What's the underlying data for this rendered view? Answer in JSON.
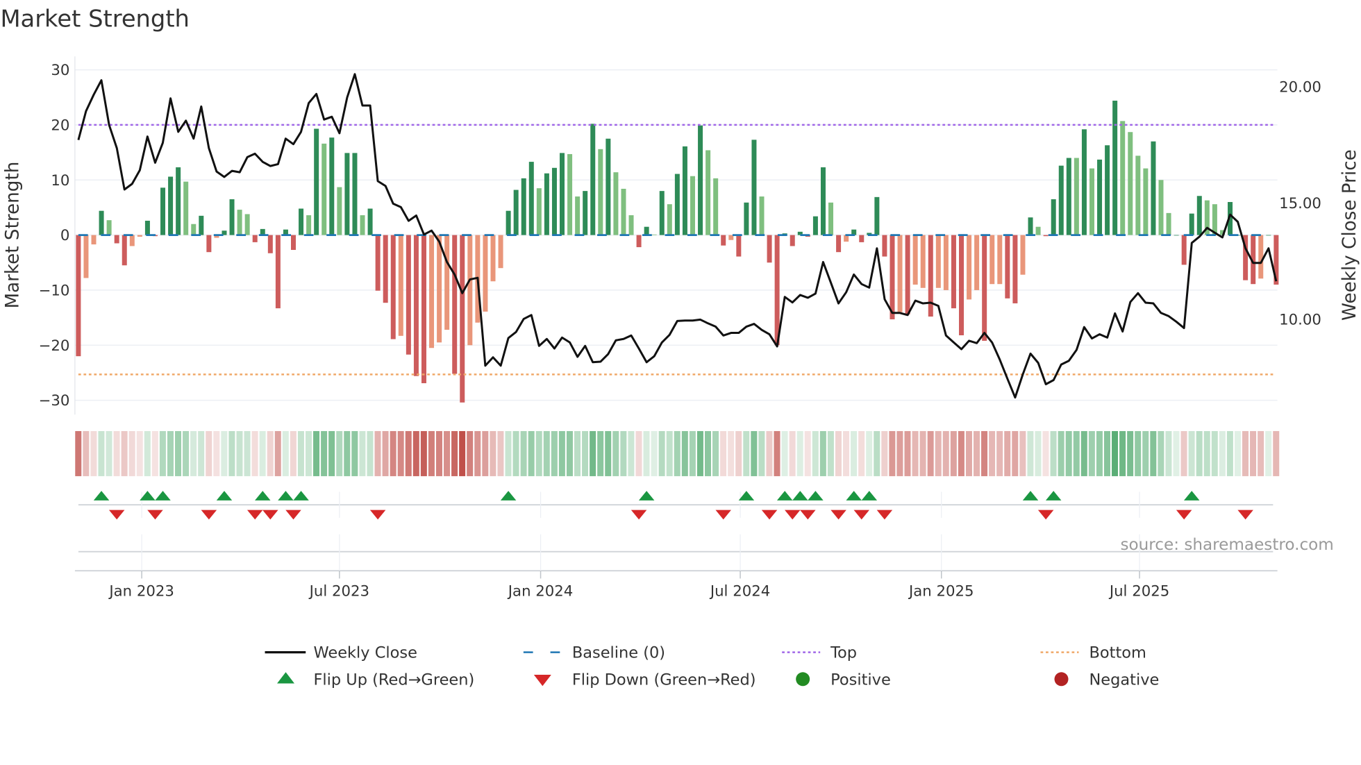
{
  "title": "Market Strength",
  "source_note": "source: sharemaestro.com",
  "colors": {
    "bar_pos_dark": "#2e8b57",
    "bar_pos_light": "#7fbf7f",
    "bar_neg_dark": "#cd5c5c",
    "bar_neg_light": "#e9967a",
    "close_line": "#111111",
    "baseline": "#1f77b4",
    "top_line": "#a066e8",
    "bottom_line": "#f0a868",
    "flip_up": "#1a9641",
    "flip_down": "#d62728",
    "positive": "#228b22",
    "negative": "#b22222",
    "strip_pos": "#3c9f5c",
    "strip_neg": "#c0504a",
    "grid": "#eceff4"
  },
  "legend": [
    {
      "key": "weekly_close",
      "label": "Weekly Close",
      "symbol": "solid-line"
    },
    {
      "key": "baseline",
      "label": "Baseline (0)",
      "symbol": "dashed-line"
    },
    {
      "key": "top",
      "label": "Top",
      "symbol": "dotted-line-purple"
    },
    {
      "key": "bottom",
      "label": "Bottom",
      "symbol": "dotted-line-orange"
    },
    {
      "key": "flip_up",
      "label": "Flip Up (Red→Green)",
      "symbol": "triangle-up"
    },
    {
      "key": "flip_down",
      "label": "Flip Down (Green→Red)",
      "symbol": "triangle-down"
    },
    {
      "key": "positive",
      "label": "Positive",
      "symbol": "dot-green"
    },
    {
      "key": "negative",
      "label": "Negative",
      "symbol": "dot-red"
    }
  ],
  "chart_data": {
    "type": "bar",
    "title": "Market Strength",
    "ylabel": "Market Strength",
    "y2label": "Weekly Close Price",
    "ylim": [
      -32.5,
      33
    ],
    "y2lim": [
      6.06,
      21.3
    ],
    "yticks": [
      {
        "value": 30,
        "label": "30"
      },
      {
        "value": 20,
        "label": "20"
      },
      {
        "value": 10,
        "label": "10"
      },
      {
        "value": 0,
        "label": "0"
      },
      {
        "value": -10,
        "label": "−10"
      },
      {
        "value": -20,
        "label": "−20"
      },
      {
        "value": -30,
        "label": "−30"
      }
    ],
    "y2ticks": [
      {
        "value": 20,
        "label": "20.00"
      },
      {
        "value": 15,
        "label": "15.00"
      },
      {
        "value": 10,
        "label": "10.00"
      }
    ],
    "x_unit": "week index",
    "xticks": [
      {
        "week": 8.25,
        "label": "Jan 2023"
      },
      {
        "week": 34.0,
        "label": "Jul 2023"
      },
      {
        "week": 60.2,
        "label": "Jan 2024"
      },
      {
        "week": 86.2,
        "label": "Jul 2024"
      },
      {
        "week": 112.4,
        "label": "Jan 2025"
      },
      {
        "week": 138.2,
        "label": "Jul 2025"
      }
    ],
    "top_level": 20,
    "bottom_level": -25.3,
    "baseline": 0,
    "strength": [
      -22,
      -7.8,
      -1.7,
      4.4,
      2.7,
      -1.5,
      -5.5,
      -2,
      -0.3,
      2.6,
      -0.2,
      8.6,
      10.6,
      12.3,
      9.7,
      2,
      3.5,
      -3.1,
      -0.5,
      0.8,
      6.5,
      4.6,
      3.8,
      -1.3,
      1.1,
      -3.3,
      -13.3,
      1,
      -2.7,
      4.8,
      3.6,
      19.3,
      16.6,
      17.7,
      8.7,
      14.9,
      14.9,
      3.6,
      4.8,
      -10.1,
      -12.3,
      -18.9,
      -18.3,
      -21.7,
      -25.6,
      -26.9,
      -20.5,
      -19.5,
      -17.2,
      -25.2,
      -30.4,
      -20,
      -15.9,
      -13.9,
      -8.4,
      -6,
      4.4,
      8.2,
      10.3,
      13.3,
      8.5,
      11.2,
      12.2,
      14.9,
      14.7,
      7,
      8,
      20.2,
      15.6,
      17.5,
      11.4,
      8.4,
      3.6,
      -2.2,
      1.5,
      0.1,
      8,
      5.6,
      11.1,
      16.1,
      10.7,
      19.9,
      15.4,
      10.3,
      -1.9,
      -0.9,
      -3.9,
      5.9,
      17.3,
      7,
      -5,
      -20,
      0.3,
      -2,
      0.6,
      -0.3,
      3.4,
      12.3,
      5.9,
      -3.1,
      -1.2,
      1,
      -1.3,
      0.4,
      6.9,
      -3.9,
      -15.3,
      -14,
      -14.4,
      -9,
      -9.6,
      -14.8,
      -9.6,
      -10,
      -13.3,
      -18.2,
      -11.7,
      -10,
      -19.2,
      -8.9,
      -8.9,
      -11.5,
      -12.4,
      -7.2,
      3.2,
      1.5,
      -0.2,
      6.5,
      12.6,
      14,
      14,
      19.2,
      12.1,
      13.7,
      16.3,
      24.4,
      20.7,
      18.7,
      14.4,
      12.1,
      17,
      10,
      4,
      0,
      -5.4,
      3.9,
      7.1,
      6.3,
      5.6,
      0.9,
      6,
      0,
      -8.2,
      -8.9,
      -7.9,
      0,
      -9
    ],
    "strength_shade_dark": [
      1,
      0,
      0,
      1,
      0,
      1,
      1,
      0,
      0,
      1,
      1,
      1,
      1,
      1,
      0,
      0,
      1,
      1,
      0,
      1,
      1,
      0,
      0,
      1,
      1,
      1,
      1,
      1,
      1,
      1,
      0,
      1,
      0,
      1,
      0,
      1,
      1,
      0,
      1,
      1,
      1,
      1,
      0,
      1,
      1,
      1,
      0,
      0,
      0,
      1,
      1,
      0,
      0,
      0,
      0,
      0,
      1,
      1,
      1,
      1,
      0,
      1,
      1,
      1,
      0,
      0,
      1,
      1,
      0,
      1,
      0,
      0,
      0,
      1,
      1,
      0,
      1,
      0,
      1,
      1,
      0,
      1,
      0,
      0,
      1,
      0,
      1,
      1,
      1,
      0,
      1,
      1,
      1,
      1,
      1,
      1,
      1,
      1,
      0,
      1,
      0,
      1,
      1,
      1,
      1,
      1,
      1,
      0,
      1,
      0,
      0,
      1,
      0,
      0,
      1,
      1,
      0,
      0,
      1,
      0,
      0,
      1,
      1,
      0,
      1,
      0,
      1,
      1,
      1,
      1,
      0,
      1,
      0,
      1,
      1,
      1,
      0,
      0,
      0,
      0,
      1,
      0,
      0,
      1,
      1,
      1,
      1,
      0,
      0,
      0,
      1,
      1,
      1,
      1,
      0,
      1,
      1
    ],
    "weekly_close": [
      17.71,
      18.95,
      19.66,
      20.28,
      18.36,
      17.36,
      15.58,
      15.82,
      16.41,
      17.86,
      16.73,
      17.59,
      19.5,
      18.06,
      18.54,
      17.77,
      19.15,
      17.36,
      16.35,
      16.12,
      16.38,
      16.32,
      16.97,
      17.12,
      16.77,
      16.59,
      16.67,
      17.77,
      17.53,
      18.06,
      19.3,
      19.69,
      18.59,
      18.71,
      18.0,
      19.54,
      20.54,
      19.19,
      19.19,
      15.94,
      15.73,
      14.97,
      14.82,
      14.23,
      14.46,
      13.64,
      13.81,
      13.34,
      12.46,
      11.92,
      11.12,
      11.71,
      11.78,
      8.0,
      8.36,
      8.0,
      9.19,
      9.45,
      10.01,
      10.18,
      8.85,
      9.15,
      8.74,
      9.21,
      9.0,
      8.38,
      8.85,
      8.15,
      8.17,
      8.5,
      9.09,
      9.15,
      9.3,
      8.74,
      8.15,
      8.41,
      9.0,
      9.33,
      9.92,
      9.94,
      9.94,
      9.98,
      9.82,
      9.68,
      9.3,
      9.41,
      9.41,
      9.68,
      9.8,
      9.54,
      9.35,
      8.83,
      10.96,
      10.72,
      11.04,
      10.92,
      11.1,
      12.46,
      11.57,
      10.68,
      11.16,
      11.92,
      11.51,
      11.36,
      13.05,
      10.86,
      10.27,
      10.27,
      10.18,
      10.8,
      10.68,
      10.71,
      10.57,
      9.3,
      9.0,
      8.71,
      9.07,
      8.97,
      9.41,
      9.0,
      8.26,
      7.44,
      6.63,
      7.62,
      8.52,
      8.12,
      7.2,
      7.38,
      8.05,
      8.21,
      8.68,
      9.66,
      9.17,
      9.35,
      9.21,
      10.25,
      9.47,
      10.74,
      11.12,
      10.71,
      10.68,
      10.27,
      10.13,
      9.89,
      9.62,
      13.28,
      13.55,
      13.93,
      13.72,
      13.52,
      14.5,
      14.19,
      13.05,
      12.42,
      12.42,
      13.05,
      11.63
    ],
    "flip_up_weeks": [
      3,
      9,
      11,
      19,
      24,
      27,
      29,
      56,
      74,
      87,
      92,
      94,
      96,
      101,
      103,
      124,
      127,
      145
    ],
    "flip_down_weeks": [
      5,
      10,
      17,
      23,
      25,
      28,
      39,
      73,
      84,
      90,
      93,
      95,
      99,
      102,
      105,
      126,
      144,
      152
    ]
  }
}
